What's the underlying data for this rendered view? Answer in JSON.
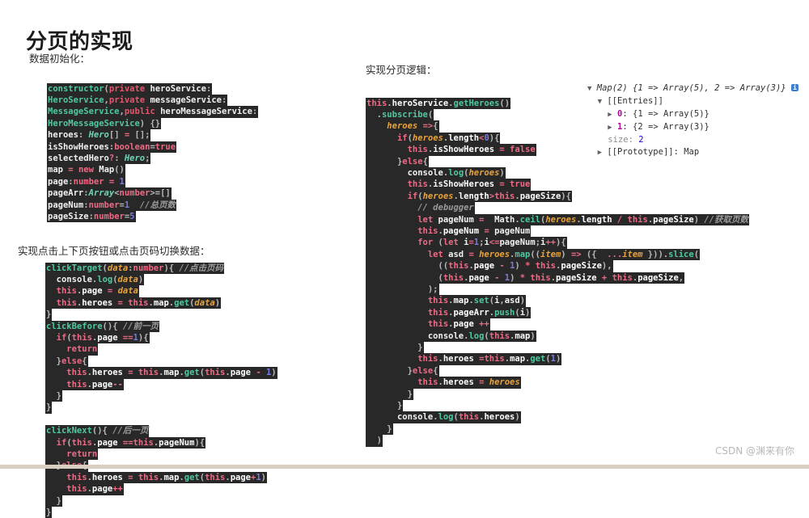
{
  "page": {
    "title": "分页的实现",
    "watermark": "CSDN @渊来有你"
  },
  "sections": {
    "init_label": "数据初始化：",
    "clicks_label": "实现点击上下页按钮或点击页码切换数据：",
    "logic_label": "实现分页逻辑："
  },
  "code_init": {
    "language": "typescript",
    "lines": [
      "constructor(private heroService:",
      "HeroService,private messageService:",
      "MessageService,public heroMessageService:",
      "HeroMessageService) {}",
      "heroes: Hero[] = [];",
      "isShowHeroes:boolean=true",
      "selectedHero?: Hero;",
      "map = new Map()",
      "page:number = 1",
      "pageArr:Array<number>=[]",
      "pageNum:number=1  //总页数",
      "pageSize:number=5"
    ]
  },
  "code_clicks": {
    "language": "typescript",
    "lines": [
      "clickTarget(data:number){ //点击页码",
      "  console.log(data)",
      "  this.page = data",
      "  this.heroes = this.map.get(data)",
      "}",
      "clickBefore(){ //前一页",
      "  if(this.page ==1){",
      "    return",
      "  }else{",
      "    this.heroes = this.map.get(this.page - 1)",
      "    this.page--",
      "  }",
      "}",
      "",
      "clickNext(){ //后一页",
      "  if(this.page ==this.pageNum){",
      "    return",
      "  }else{",
      "    this.heroes = this.map.get(this.page+1)",
      "    this.page++",
      "  }",
      "}"
    ]
  },
  "code_logic": {
    "language": "typescript",
    "lines": [
      "this.heroService.getHeroes()",
      "  .subscribe(",
      "    heroes =>{",
      "      if(heroes.length<0){",
      "        this.isShowHeroes = false",
      "      }else{",
      "        console.log(heroes)",
      "        this.isShowHeroes = true",
      "        if(heroes.length>this.pageSize){",
      "          // debugger",
      "          let pageNum =  Math.ceil(heroes.length / this.pageSize) //获取页数",
      "          this.pageNum = pageNum",
      "          for (let i=1;i<=pageNum;i++){",
      "            let asd = heroes.map((item) => ({  ...item })).slice(",
      "              ((this.page - 1) * this.pageSize),",
      "              (this.page - 1) * this.pageSize + this.pageSize,",
      "            );",
      "            this.map.set(i,asd)",
      "            this.pageArr.push(i)",
      "            this.page ++",
      "            console.log(this.map)",
      "          }",
      "          this.heroes =this.map.get(1)",
      "        }else{",
      "          this.heroes = heroes",
      "        }",
      "      }",
      "      console.log(this.heroes)",
      "    }",
      "  )"
    ]
  },
  "console_output": {
    "header": "Map(2) {1 => Array(5), 2 => Array(3)}",
    "info_badge": "i",
    "entries_label": "[[Entries]]",
    "entries": [
      {
        "index": "0",
        "value": "{1 => Array(5)}"
      },
      {
        "index": "1",
        "value": "{2 => Array(3)}"
      }
    ],
    "size_key": "size:",
    "size_value": "2",
    "prototype_label": "[[Prototype]]: Map"
  },
  "colors": {
    "code_background": "#282828",
    "page_background": "#ffffff",
    "keyword": "#e8556d",
    "function": "#4ec9a0",
    "type": "#6fd3b8",
    "italic_var": "#e8a33d",
    "number": "#7a7ce0",
    "comment": "#9b9b9b",
    "footer_strip": "#d8cfc0"
  }
}
